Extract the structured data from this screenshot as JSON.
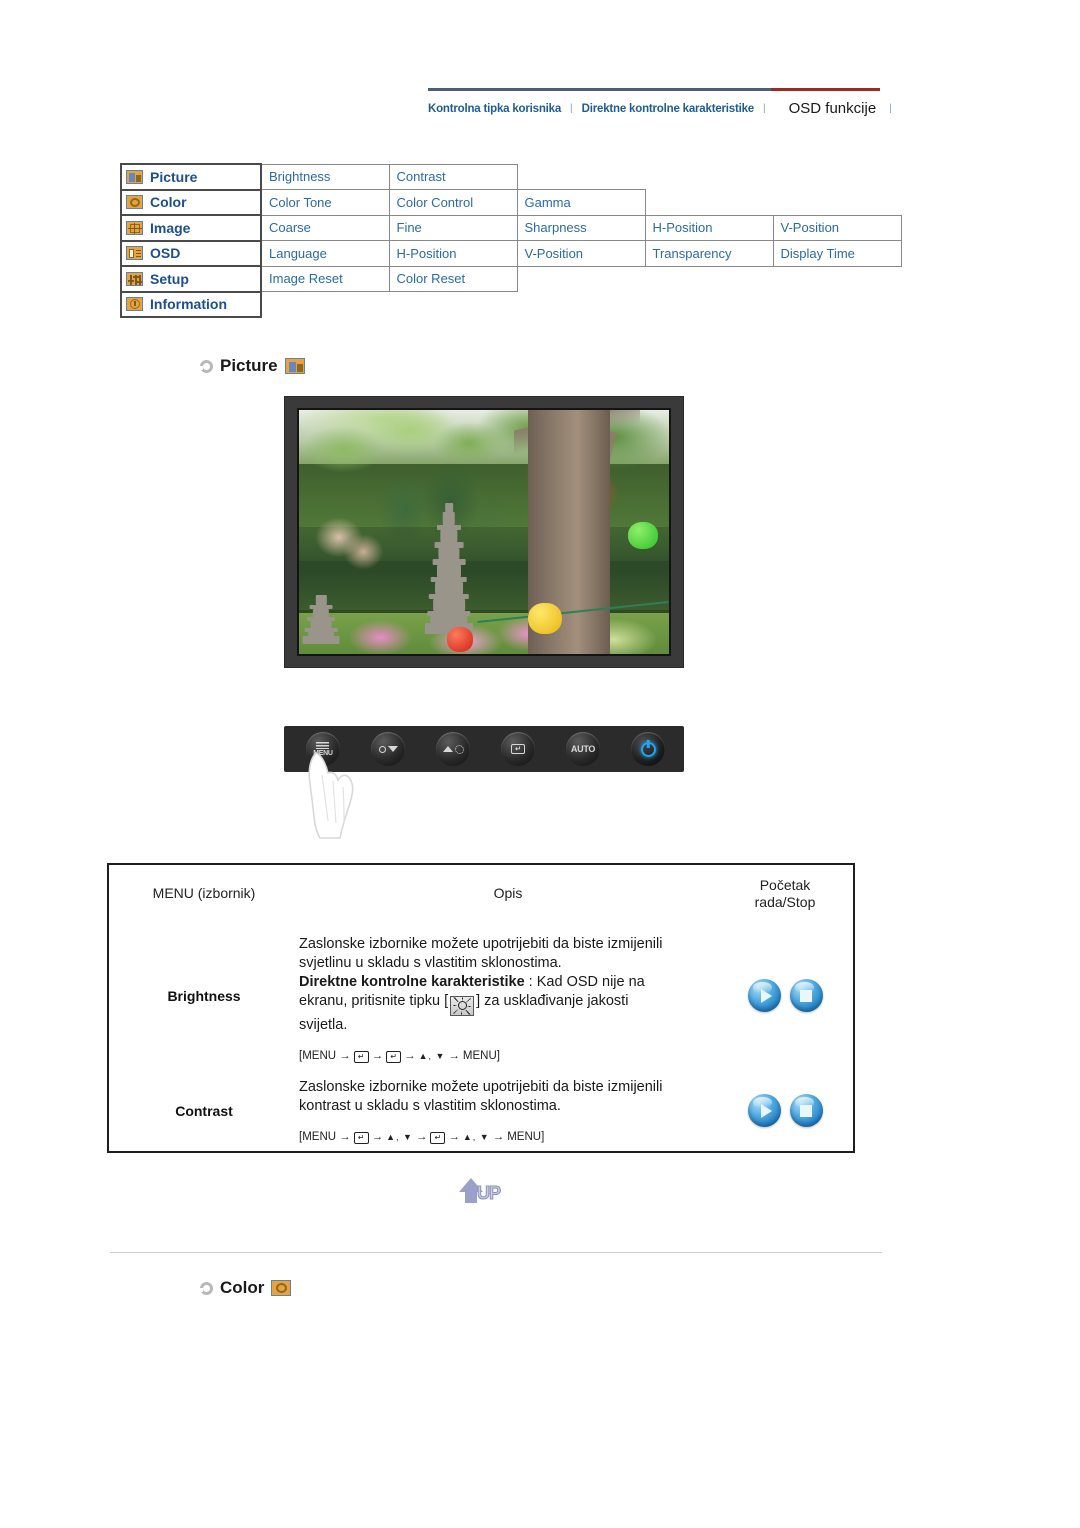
{
  "topnav": {
    "items": [
      {
        "label": "Kontrolna tipka korisnika",
        "active": false
      },
      {
        "label": "Direktne kontrolne karakteristike",
        "active": false
      },
      {
        "label": "OSD funkcije",
        "active": true
      }
    ],
    "separator": "|",
    "accent_color": "#9e2b1f",
    "rule_color": "#4a6076",
    "link_color": "#1f5c93"
  },
  "menumap": {
    "rows": [
      {
        "icon": "picture-icon",
        "category": "Picture",
        "subitems": [
          "Brightness",
          "Contrast"
        ]
      },
      {
        "icon": "color-icon",
        "category": "Color",
        "subitems": [
          "Color Tone",
          "Color Control",
          "Gamma"
        ]
      },
      {
        "icon": "image-icon",
        "category": "Image",
        "subitems": [
          "Coarse",
          "Fine",
          "Sharpness",
          "H-Position",
          "V-Position"
        ]
      },
      {
        "icon": "osd-icon",
        "category": "OSD",
        "subitems": [
          "Language",
          "H-Position",
          "V-Position",
          "Transparency",
          "Display Time"
        ]
      },
      {
        "icon": "setup-icon",
        "category": "Setup",
        "subitems": [
          "Image Reset",
          "Color Reset"
        ]
      },
      {
        "icon": "information-icon",
        "category": "Information",
        "subitems": []
      }
    ],
    "icon_color": "#e8a33d",
    "text_color": "#2b6aa8"
  },
  "sections": {
    "picture": {
      "title": "Picture",
      "icon": "picture-icon"
    },
    "color": {
      "title": "Color",
      "icon": "color-icon"
    }
  },
  "buttonbar": {
    "buttons": [
      {
        "name": "menu-button",
        "label": "MENU"
      },
      {
        "name": "down-adjust-button",
        "label": ""
      },
      {
        "name": "brightness-button",
        "label": ""
      },
      {
        "name": "enter-button",
        "label": ""
      },
      {
        "name": "auto-button",
        "label": "AUTO"
      },
      {
        "name": "power-button",
        "label": ""
      }
    ]
  },
  "desctable": {
    "headers": {
      "menu": "MENU (izbornik)",
      "description": "Opis",
      "start_line1": "Početak",
      "start_line2": "rada/Stop"
    },
    "rows": [
      {
        "label": "Brightness",
        "text_line1": "Zaslonske izbornike možete upotrijebiti da biste izmijenili",
        "text_line2": "svjetlinu u skladu s vlastitim sklonostima.",
        "bold_lead": "Direktne kontrolne karakteristike",
        "text_line3": " : Kad OSD nije na",
        "text_line4_pre": "ekranu, pritisnite tipku [",
        "text_line4_post": "] za usklađivanje jakosti",
        "text_line5": "svijetla.",
        "sequence": [
          "[MENU",
          "→",
          "ENTER",
          "→",
          "ENTER",
          "→",
          "▲, ▼",
          "→",
          "MENU]"
        ],
        "controls": [
          "play-button",
          "stop-button"
        ]
      },
      {
        "label": "Contrast",
        "text_line1": "Zaslonske izbornike možete upotrijebiti da biste izmijenili",
        "text_line2": "kontrast u skladu s vlastitim sklonostima.",
        "sequence": [
          "[MENU",
          "→",
          "ENTER",
          "→",
          "▲, ▼",
          "→",
          "ENTER",
          "→",
          "▲, ▼",
          "→",
          "MENU]"
        ],
        "controls": [
          "play-button",
          "stop-button"
        ]
      }
    ]
  },
  "upbutton": {
    "label": "UP"
  }
}
